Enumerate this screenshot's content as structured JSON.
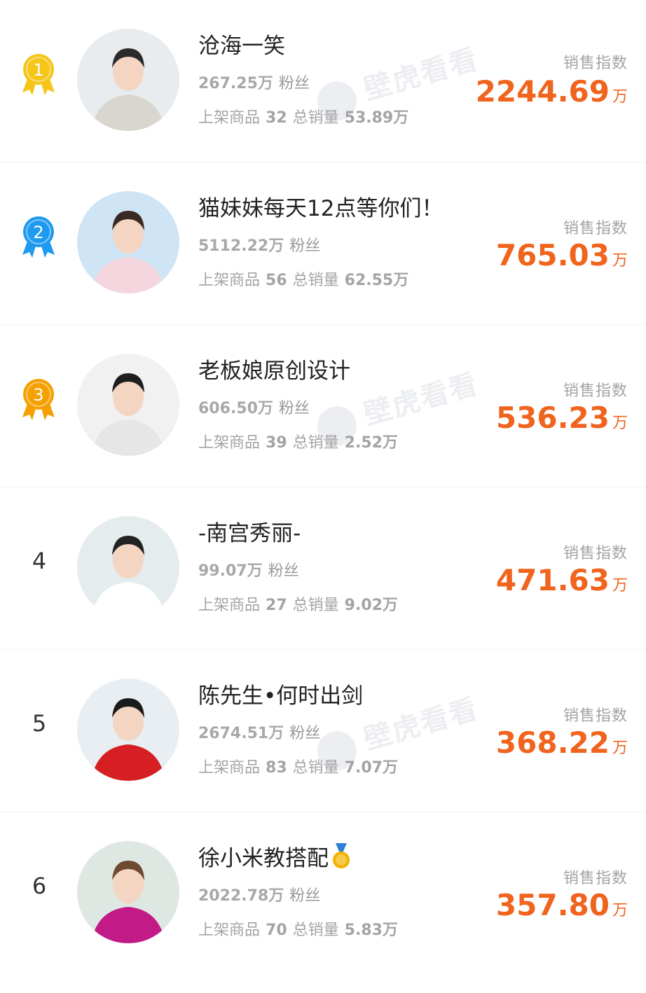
{
  "index_label": "销售指数",
  "colors": {
    "accent": "#f0641e",
    "gold": "#f5c518",
    "blue": "#1e9bf0",
    "orange": "#f5a000"
  },
  "watermark": "壁虎看看",
  "streamers": [
    {
      "rank": "1",
      "medal": "gold",
      "name": "沧海一笑",
      "fans_value": "267.25万",
      "fans_label": "粉丝",
      "goods_label": "上架商品",
      "goods_count": "32",
      "sales_label": "总销量",
      "sales_value": "53.89万",
      "index_value": "2244.69",
      "index_unit": "万",
      "trophy": false
    },
    {
      "rank": "2",
      "medal": "blue",
      "name": "猫妹妹每天12点等你们！",
      "fans_value": "5112.22万",
      "fans_label": "粉丝",
      "goods_label": "上架商品",
      "goods_count": "56",
      "sales_label": "总销量",
      "sales_value": "62.55万",
      "index_value": "765.03",
      "index_unit": "万",
      "trophy": false
    },
    {
      "rank": "3",
      "medal": "orange",
      "name": "老板娘原创设计",
      "fans_value": "606.50万",
      "fans_label": "粉丝",
      "goods_label": "上架商品",
      "goods_count": "39",
      "sales_label": "总销量",
      "sales_value": "2.52万",
      "index_value": "536.23",
      "index_unit": "万",
      "trophy": false
    },
    {
      "rank": "4",
      "medal": "",
      "name": "-南宫秀丽-",
      "fans_value": "99.07万",
      "fans_label": "粉丝",
      "goods_label": "上架商品",
      "goods_count": "27",
      "sales_label": "总销量",
      "sales_value": "9.02万",
      "index_value": "471.63",
      "index_unit": "万",
      "trophy": false
    },
    {
      "rank": "5",
      "medal": "",
      "name": "陈先生•何时出剑",
      "fans_value": "2674.51万",
      "fans_label": "粉丝",
      "goods_label": "上架商品",
      "goods_count": "83",
      "sales_label": "总销量",
      "sales_value": "7.07万",
      "index_value": "368.22",
      "index_unit": "万",
      "trophy": false
    },
    {
      "rank": "6",
      "medal": "",
      "name": "徐小米教搭配",
      "fans_value": "2022.78万",
      "fans_label": "粉丝",
      "goods_label": "上架商品",
      "goods_count": "70",
      "sales_label": "总销量",
      "sales_value": "5.83万",
      "index_value": "357.80",
      "index_unit": "万",
      "trophy": true
    }
  ]
}
